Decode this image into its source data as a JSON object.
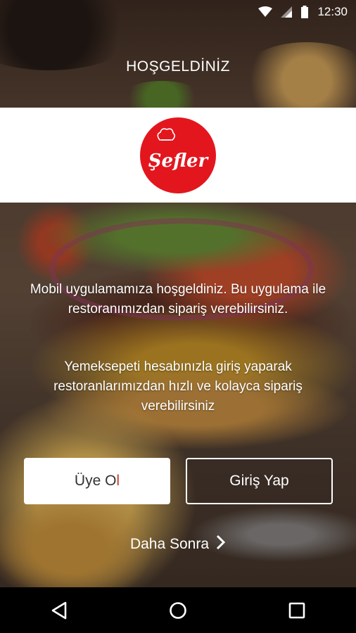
{
  "status_bar": {
    "time": "12:30"
  },
  "header": {
    "title": "HOŞGELDİNİZ"
  },
  "brand": {
    "logo_text": "Şefler",
    "logo_color": "#e3161e"
  },
  "intro": {
    "message_1": "Mobil uygulamamıza hoşgeldiniz. Bu uygulama ile restoranımızdan sipariş verebilirsiniz.",
    "message_2": "Yemeksepeti hesabınızla giriş yaparak restoranlarımızdan hızlı ve kolayca sipariş verebilirsiniz"
  },
  "actions": {
    "signup_label_main": "Üye O",
    "signup_label_accent": "l",
    "login_label": "Giriş Yap",
    "later_label": "Daha Sonra"
  },
  "icons": {
    "wifi": "wifi-icon",
    "signal": "signal-icon",
    "battery": "battery-icon",
    "back": "back-icon",
    "home": "home-icon",
    "recents": "recents-icon",
    "chevron": "chevron-right-icon"
  }
}
